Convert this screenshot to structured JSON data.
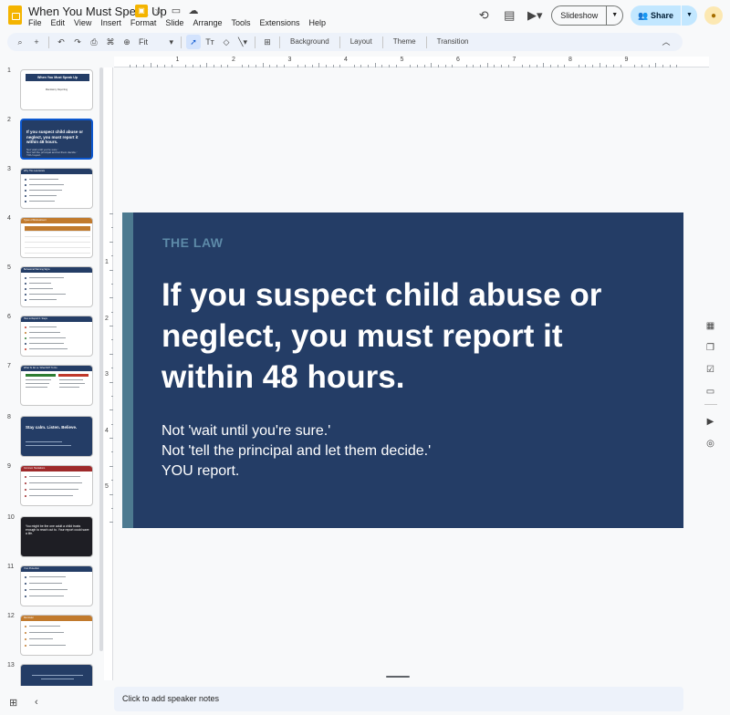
{
  "app": {
    "doc_title": "When You Must Speak Up",
    "menu": [
      "File",
      "Edit",
      "View",
      "Insert",
      "Format",
      "Slide",
      "Arrange",
      "Tools",
      "Extensions",
      "Help"
    ],
    "slideshow_label": "Slideshow",
    "share_label": "Share"
  },
  "toolbar": {
    "zoom": "Fit",
    "background_label": "Background",
    "layout_label": "Layout",
    "theme_label": "Theme",
    "transition_label": "Transition"
  },
  "ruler": {
    "h_marks": [
      "1",
      "2",
      "3",
      "4",
      "5",
      "6",
      "7",
      "8",
      "9"
    ],
    "v_marks": [
      "1",
      "2",
      "3",
      "4",
      "5"
    ]
  },
  "filmstrip": {
    "slides": [
      {
        "num": "1",
        "title": "When You Must Speak Up",
        "subtitle": "Mandatory Reporting"
      },
      {
        "num": "2",
        "title": "If you suspect child abuse or neglect, you must report it within 48 hours.",
        "lines": [
          "Not 'wait until you're sure.'",
          "Not 'tell the principal and let them decide.'",
          "YOU report."
        ]
      },
      {
        "num": "3",
        "title": "Why This Law Exists"
      },
      {
        "num": "4",
        "title": "Types of Mistreatment"
      },
      {
        "num": "5",
        "title": "Behavioral Warning Signs"
      },
      {
        "num": "6",
        "title": "How to Report It: Steps"
      },
      {
        "num": "7",
        "title": "What To Do vs. What NOT To Do"
      },
      {
        "num": "8",
        "title": "Stay calm. Listen. Believe."
      },
      {
        "num": "9",
        "title": "Common Hesitations"
      },
      {
        "num": "10",
        "title": "You might be the one adult a child trusts enough to reach out to. Your report could save a life."
      },
      {
        "num": "11",
        "title": "Your Protection"
      },
      {
        "num": "12",
        "title": "Reminder"
      },
      {
        "num": "13",
        "title": ""
      }
    ]
  },
  "slide": {
    "kicker": "THE LAW",
    "headline": "If you suspect child abuse or neglect, you must report it within 48 hours.",
    "body_lines": [
      "Not 'wait until you're sure.'",
      "Not 'tell the principal and let them decide.'",
      "YOU report."
    ]
  },
  "notes": {
    "placeholder": "Click to add speaker notes"
  },
  "colors": {
    "slide_bg": "#243d66",
    "accent_bar": "#4d7a90",
    "kicker": "#5d8aa8",
    "share_bg": "#c2e7ff",
    "selection": "#0b57d0"
  }
}
